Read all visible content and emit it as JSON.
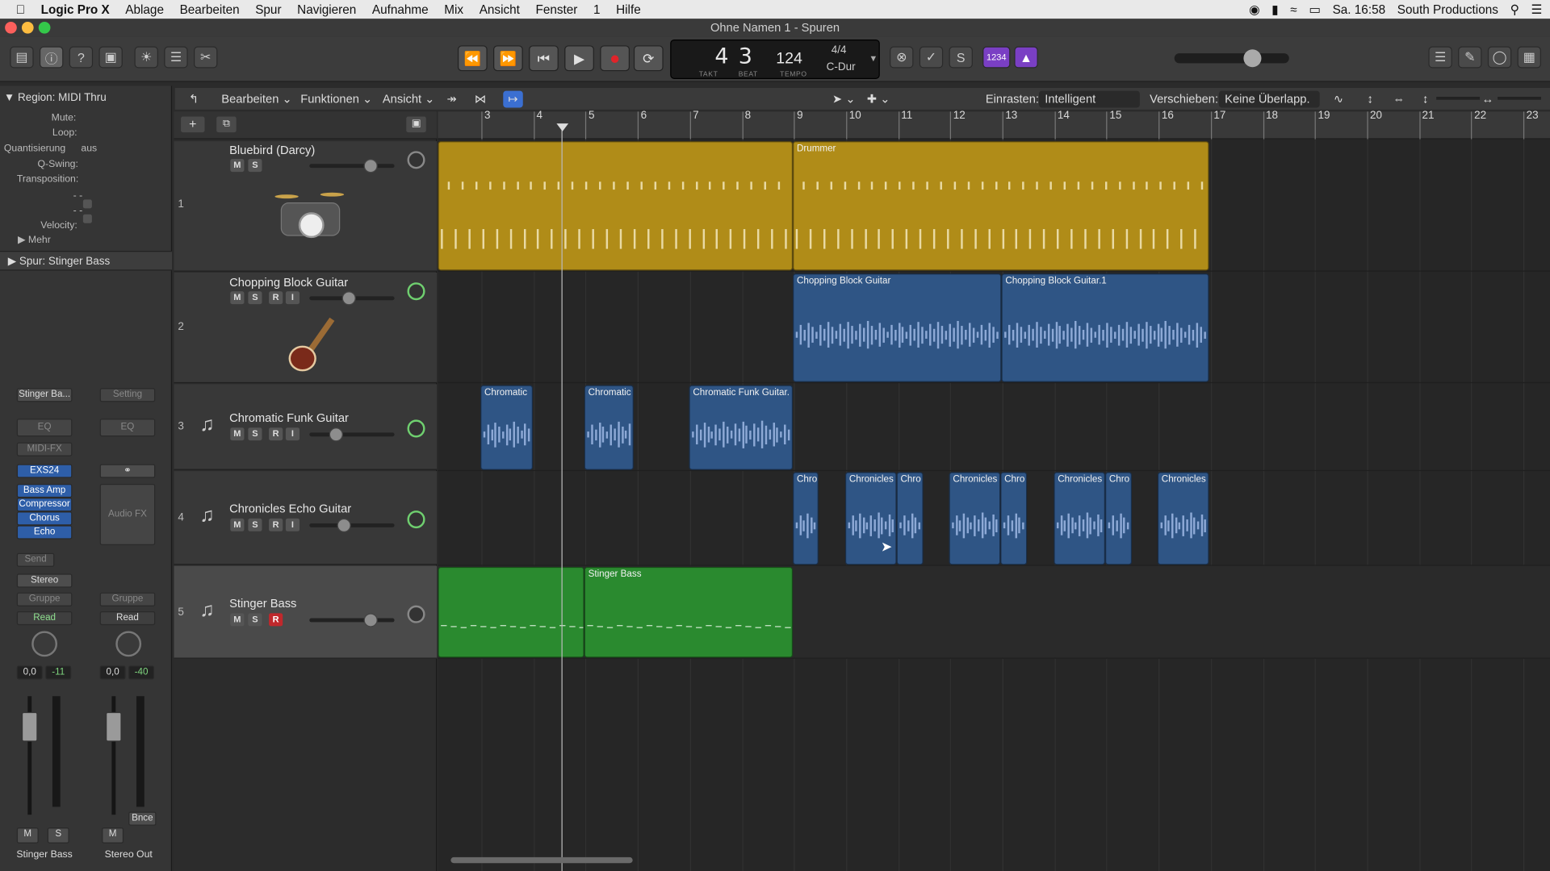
{
  "menubar": {
    "app": "Logic Pro X",
    "items": [
      "Ablage",
      "Bearbeiten",
      "Spur",
      "Navigieren",
      "Aufnahme",
      "Mix",
      "Ansicht",
      "Fenster",
      "1",
      "Hilfe"
    ],
    "clock": "Sa. 16:58",
    "user": "South Productions"
  },
  "window": {
    "title": "Ohne Namen 1 - Spuren"
  },
  "lcd": {
    "bar": "4",
    "beat": "3",
    "tempo": "124",
    "signature": "4/4",
    "key": "C-Dur",
    "lbl_takt": "TAKT",
    "lbl_beat": "BEAT",
    "lbl_tempo": "TEMPO",
    "count_in": "1234"
  },
  "inspector": {
    "region": "Region: MIDI Thru",
    "mute": "Mute:",
    "loop": "Loop:",
    "quant": "Quantisierung",
    "quant_val": "aus",
    "qswing": "Q-Swing:",
    "transp": "Transposition:",
    "dash1": "- -",
    "dash2": "- -",
    "velocity": "Velocity:",
    "mehr": "Mehr",
    "spur": "Spur: Stinger Bass"
  },
  "strip1": {
    "name": "Stinger Ba...",
    "eq": "EQ",
    "midifx": "MIDI-FX",
    "instr": "EXS24",
    "fx": [
      "Bass Amp",
      "Compressor",
      "Chorus",
      "Echo"
    ],
    "send": "Send",
    "stereo": "Stereo",
    "gruppe": "Gruppe",
    "read": "Read",
    "vol": "0,0",
    "peak": "-11",
    "m": "M",
    "s": "S",
    "label": "Stinger Bass"
  },
  "strip2": {
    "name": "Setting",
    "eq": "EQ",
    "audiofx": "Audio FX",
    "gruppe": "Gruppe",
    "read": "Read",
    "vol": "0,0",
    "peak": "-40",
    "bnce": "Bnce",
    "m": "M",
    "label": "Stereo Out"
  },
  "arrangebar": {
    "bearbeiten": "Bearbeiten",
    "funktionen": "Funktionen",
    "ansicht": "Ansicht",
    "einrasten": "Einrasten:",
    "einrasten_val": "Intelligent",
    "verschieben": "Verschieben:",
    "verschieben_val": "Keine Überlapp."
  },
  "ruler": [
    "3",
    "4",
    "5",
    "6",
    "7",
    "8",
    "9",
    "10",
    "11",
    "12",
    "13",
    "14",
    "15",
    "16",
    "17",
    "18",
    "19",
    "20",
    "21",
    "22",
    "23"
  ],
  "tracks": [
    {
      "num": "1",
      "name": "Bluebird (Darcy)",
      "m": "M",
      "s": "S"
    },
    {
      "num": "2",
      "name": "Chopping Block Guitar",
      "m": "M",
      "s": "S",
      "r": "R",
      "i": "I"
    },
    {
      "num": "3",
      "name": "Chromatic Funk Guitar",
      "m": "M",
      "s": "S",
      "r": "R",
      "i": "I"
    },
    {
      "num": "4",
      "name": "Chronicles Echo Guitar",
      "m": "M",
      "s": "S",
      "r": "R",
      "i": "I"
    },
    {
      "num": "5",
      "name": "Stinger Bass",
      "m": "M",
      "s": "S",
      "r": "R"
    }
  ],
  "regions": {
    "drummer": "Drummer",
    "cbg1": "Chopping Block Guitar",
    "cbg2": "Chopping Block Guitar.1",
    "chrom1": "Chromatic",
    "chrom2": "Chromatic",
    "chrom3": "Chromatic Funk Guitar.",
    "chro": "Chro",
    "chron": "Chronicles",
    "bass": "Stinger Bass"
  }
}
